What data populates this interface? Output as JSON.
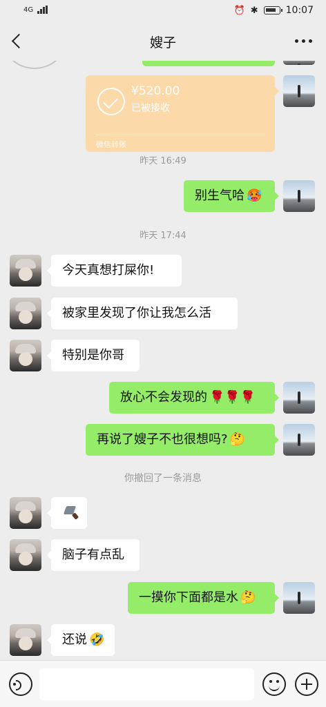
{
  "status_bar": {
    "time": "10:07",
    "network": "4G"
  },
  "header": {
    "title": "嫂子"
  },
  "messages": [
    {
      "type": "transfer",
      "amount": "¥520.00",
      "status": "已被接收",
      "label": "微信转账",
      "sender": "me"
    },
    {
      "type": "timestamp",
      "text": "昨天 16:49"
    },
    {
      "type": "text",
      "sender": "me",
      "text": "别生气哈",
      "emoji": "🥵"
    },
    {
      "type": "timestamp",
      "text": "昨天 17:44"
    },
    {
      "type": "text",
      "sender": "her",
      "text": "今天真想打屎你!"
    },
    {
      "type": "text",
      "sender": "her",
      "text": "被家里发现了你让我怎么活"
    },
    {
      "type": "text",
      "sender": "her",
      "text": "特别是你哥"
    },
    {
      "type": "text",
      "sender": "me",
      "text": "放心不会发现的",
      "emoji": "🌹🌹🌹"
    },
    {
      "type": "text",
      "sender": "me",
      "text": "再说了嫂子不也很想吗?",
      "emoji": "🤔"
    },
    {
      "type": "timestamp",
      "text": "你撤回了一条消息"
    },
    {
      "type": "sticker",
      "sender": "her",
      "icon": "knife-icon"
    },
    {
      "type": "text",
      "sender": "her",
      "text": "脑子有点乱"
    },
    {
      "type": "text",
      "sender": "me",
      "text": "一摸你下面都是水",
      "emoji": "🤔"
    },
    {
      "type": "text",
      "sender": "her",
      "text": "还说",
      "emoji": "🤣"
    }
  ],
  "input_bar": {
    "placeholder": ""
  },
  "colors": {
    "background": "#ededed",
    "outgoing_bubble": "#95ec69",
    "incoming_bubble": "#ffffff",
    "transfer_card": "#fbd9a8"
  }
}
